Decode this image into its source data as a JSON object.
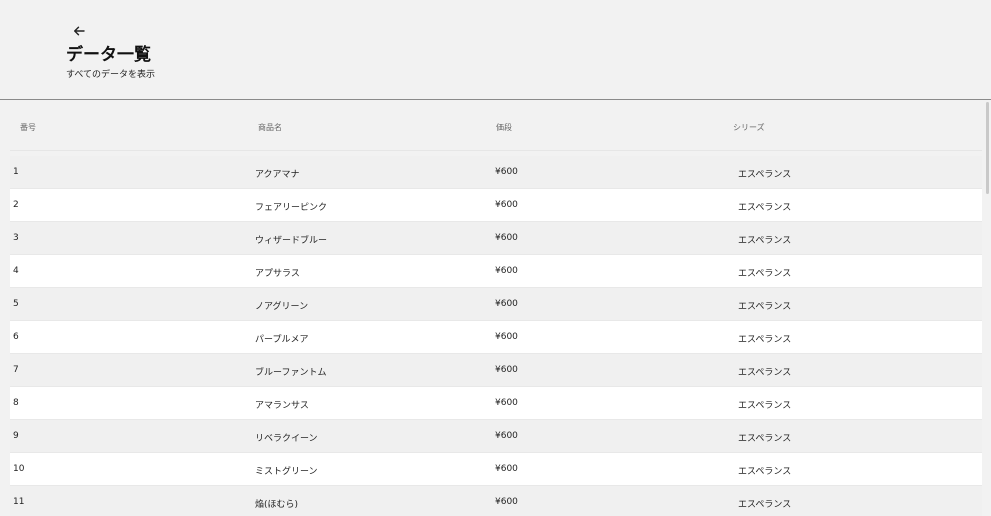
{
  "header": {
    "title": "データ一覧",
    "subtitle": "すべてのデータを表示",
    "back_icon": "arrow-left-icon"
  },
  "table": {
    "columns": [
      "番号",
      "商品名",
      "価段",
      "シリーズ"
    ],
    "rows": [
      {
        "no": "1",
        "name": "アクアマナ",
        "price": "¥600",
        "series": "エスペランス"
      },
      {
        "no": "2",
        "name": "フェアリーピンク",
        "price": "¥600",
        "series": "エスペランス"
      },
      {
        "no": "3",
        "name": "ウィザードブルー",
        "price": "¥600",
        "series": "エスペランス"
      },
      {
        "no": "4",
        "name": "アプサラス",
        "price": "¥600",
        "series": "エスペランス"
      },
      {
        "no": "5",
        "name": "ノアグリーン",
        "price": "¥600",
        "series": "エスペランス"
      },
      {
        "no": "6",
        "name": "パープルメア",
        "price": "¥600",
        "series": "エスペランス"
      },
      {
        "no": "7",
        "name": "ブルーファントム",
        "price": "¥600",
        "series": "エスペランス"
      },
      {
        "no": "8",
        "name": "アマランサス",
        "price": "¥600",
        "series": "エスペランス"
      },
      {
        "no": "9",
        "name": "リベラクイーン",
        "price": "¥600",
        "series": "エスペランス"
      },
      {
        "no": "10",
        "name": "ミストグリーン",
        "price": "¥600",
        "series": "エスペランス"
      },
      {
        "no": "11",
        "name": "焔(ほむら)",
        "price": "¥600",
        "series": "エスペランス"
      }
    ]
  }
}
